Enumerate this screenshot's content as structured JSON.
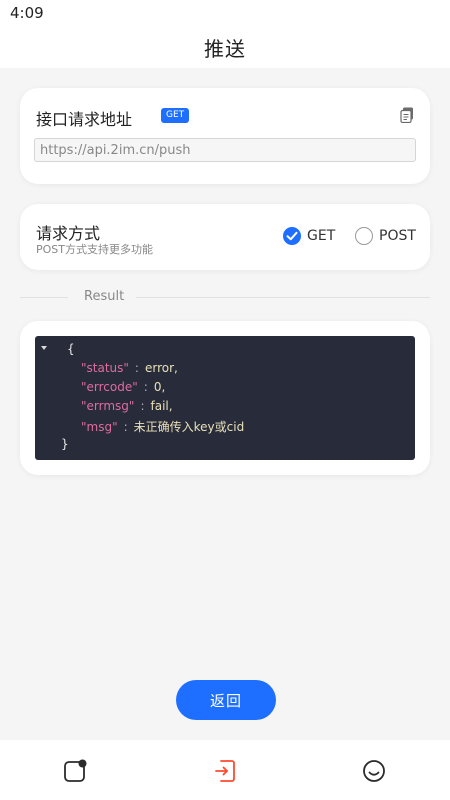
{
  "status_bar": {
    "time": "4:09"
  },
  "header": {
    "title": "推送"
  },
  "url_card": {
    "title": "接口请求地址",
    "badge": "GET",
    "copy_icon": "copy-icon",
    "url_value": "https://api.2im.cn/push"
  },
  "method_card": {
    "title": "请求方式",
    "subtitle": "POST方式支持更多功能",
    "options": [
      {
        "label": "GET",
        "checked": true
      },
      {
        "label": "POST",
        "checked": false
      }
    ]
  },
  "divider": {
    "label": "Result"
  },
  "result": {
    "open_brace": "{",
    "close_brace": "}",
    "lines": [
      {
        "key": "\"status\"",
        "colon": ":",
        "value": "error,"
      },
      {
        "key": "\"errcode\"",
        "colon": ":",
        "value": "0,"
      },
      {
        "key": "\"errmsg\"",
        "colon": ":",
        "value": "fail,"
      },
      {
        "key": "\"msg\"",
        "colon": ":",
        "value": "未正确传入key或cid"
      }
    ]
  },
  "back_button": {
    "label": "返回"
  },
  "tabbar": {
    "icons": [
      "card-notification-icon",
      "sign-in-icon",
      "smiley-icon"
    ]
  },
  "colors": {
    "accent": "#1e6fff",
    "active_tab": "#ff4a2d",
    "code_background": "#272b3a"
  }
}
